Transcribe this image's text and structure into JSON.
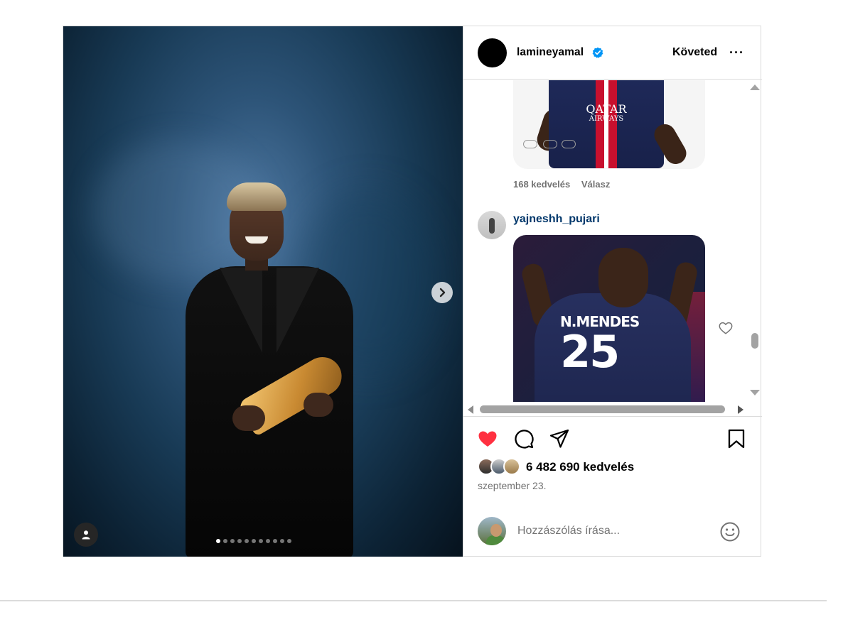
{
  "post": {
    "carousel": {
      "slide_count": 11,
      "active_index": 0
    },
    "author": {
      "username": "lamineyamal",
      "verified": true,
      "follow_label": "Követed",
      "more_label": "···"
    },
    "comments": [
      {
        "likes_label": "168 kedvelés",
        "reply_label": "Válasz",
        "gif": {
          "jersey_text": "QATAR",
          "jersey_subtext": "AIRWAYS"
        }
      },
      {
        "username": "yajneshh_pujari",
        "gif": {
          "jersey_name": "N.MENDES",
          "jersey_number": "25"
        }
      }
    ],
    "actions": {
      "liked": true,
      "like_icon": "heart-filled-icon",
      "comment_icon": "comment-icon",
      "share_icon": "share-icon",
      "save_icon": "bookmark-icon"
    },
    "likes_label": "6 482 690 kedvelés",
    "date": "szeptember 23.",
    "composer": {
      "placeholder": "Hozzászólás írása...",
      "emoji_icon": "emoji-icon"
    }
  },
  "colors": {
    "like_red": "#ff3040",
    "verified_blue": "#0095f6",
    "username_link": "#00376b",
    "muted_text": "#737373",
    "border": "#dbdbdb"
  }
}
